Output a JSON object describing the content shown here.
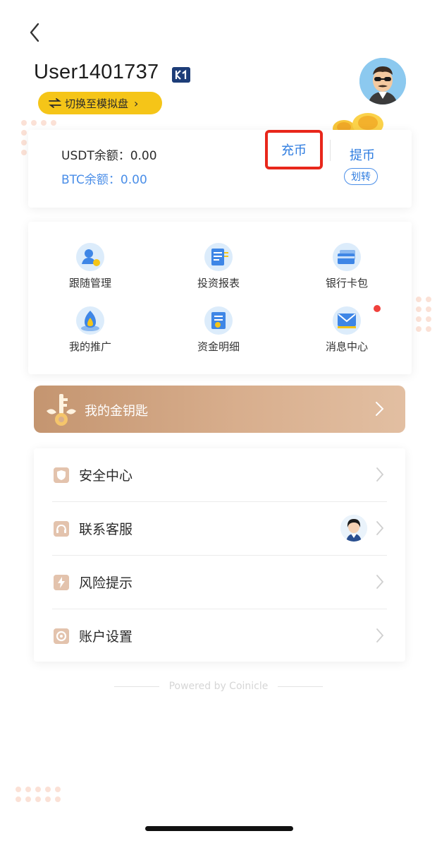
{
  "header": {
    "username": "User1401737",
    "switch_label": "切换至模拟盘"
  },
  "balance": {
    "usdt_label": "USDT余额：0.00",
    "btc_label": "BTC余额：0.00",
    "deposit_label": "充币",
    "withdraw_label": "提币",
    "transfer_label": "划转"
  },
  "grid": [
    {
      "label": "跟随管理",
      "icon": "follow-manage-icon"
    },
    {
      "label": "投资报表",
      "icon": "invest-report-icon"
    },
    {
      "label": "银行卡包",
      "icon": "bank-card-icon"
    },
    {
      "label": "我的推广",
      "icon": "promotion-icon"
    },
    {
      "label": "资金明细",
      "icon": "fund-detail-icon"
    },
    {
      "label": "消息中心",
      "icon": "message-center-icon"
    }
  ],
  "golden_key": {
    "label": "我的金钥匙"
  },
  "menu": [
    {
      "label": "安全中心",
      "icon": "shield-icon"
    },
    {
      "label": "联系客服",
      "icon": "headset-icon"
    },
    {
      "label": "风险提示",
      "icon": "lightning-icon"
    },
    {
      "label": "账户设置",
      "icon": "settings-icon"
    }
  ],
  "footer": {
    "powered_by": "Powered by Coinicle"
  },
  "colors": {
    "accent_blue": "#2e7ce0",
    "highlight_red": "#e8271b",
    "switch_yellow": "#f5c518",
    "golden_bar": "#c49570"
  }
}
